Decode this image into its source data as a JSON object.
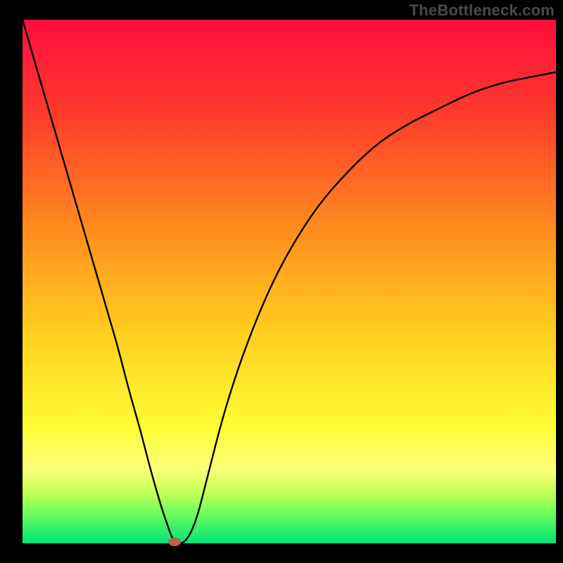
{
  "watermark": "TheBottleneck.com",
  "chart_data": {
    "type": "line",
    "title": "",
    "xlabel": "",
    "ylabel": "",
    "xlim": [
      0,
      100
    ],
    "ylim": [
      0,
      100
    ],
    "grid": false,
    "legend": false,
    "background_gradient": {
      "stops": [
        {
          "offset": 0.0,
          "color": "#ff0d3f"
        },
        {
          "offset": 0.18,
          "color": "#ff3b2b"
        },
        {
          "offset": 0.4,
          "color": "#ff8c1e"
        },
        {
          "offset": 0.6,
          "color": "#ffcf1e"
        },
        {
          "offset": 0.78,
          "color": "#fdfd35"
        },
        {
          "offset": 0.86,
          "color": "#fbff7a"
        },
        {
          "offset": 0.9,
          "color": "#c8ff54"
        },
        {
          "offset": 0.94,
          "color": "#73ff5c"
        },
        {
          "offset": 1.0,
          "color": "#00e47a"
        }
      ]
    },
    "series": [
      {
        "name": "bottleneck-curve",
        "x": [
          0,
          2,
          4,
          6,
          8,
          10,
          12,
          14,
          16,
          18,
          20,
          22,
          24,
          26,
          27,
          28,
          29,
          30,
          31,
          32,
          33,
          34,
          35,
          37,
          39,
          42,
          46,
          50,
          55,
          60,
          66,
          72,
          78,
          84,
          90,
          95,
          100
        ],
        "y": [
          100,
          93,
          86,
          79,
          72,
          65,
          58,
          51,
          44,
          37,
          29,
          22,
          14,
          7,
          4,
          1,
          0,
          0,
          1,
          3,
          6,
          10,
          14,
          22,
          29,
          38,
          48,
          56,
          64,
          70,
          76,
          80,
          83,
          86,
          88,
          89,
          90
        ]
      }
    ],
    "marker": {
      "x": 28.5,
      "y": 0,
      "color": "#c06048",
      "rx": 9,
      "ry": 6
    }
  }
}
